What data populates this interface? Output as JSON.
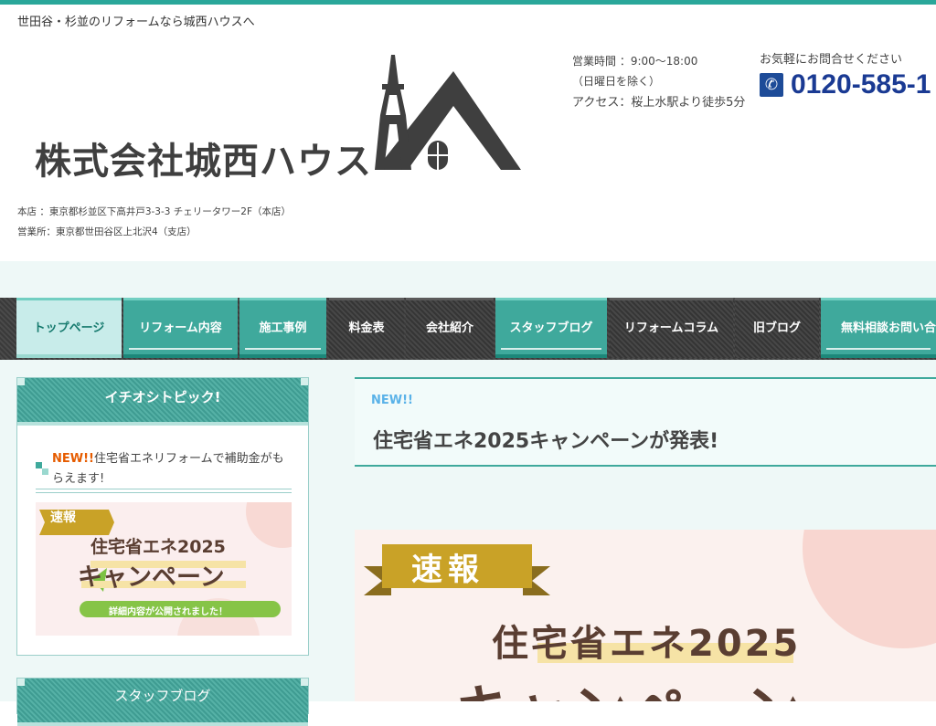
{
  "header": {
    "tagline": "世田谷・杉並のリフォームなら城西ハウスへ",
    "logo_text": "株式会社城西ハウス",
    "address_main": "本店 ：東京都杉並区下高井戸3-3-3 チェリータワー2F（本店）",
    "address_branch": "営業所：東京都世田谷区上北沢4（支店）",
    "hours_line1": "営業時間 ：9:00〜18:00",
    "hours_line2": "（日曜日を除く）",
    "access": "アクセス：桜上水駅より徒歩5分",
    "contact_label": "お気軽にお問合せください",
    "phone": "0120-585-1"
  },
  "nav": {
    "items": [
      {
        "label": "トップページ"
      },
      {
        "label": "リフォーム内容"
      },
      {
        "label": "施工事例"
      },
      {
        "label": "料金表"
      },
      {
        "label": "会社紹介"
      },
      {
        "label": "スタッフブログ"
      },
      {
        "label": "リフォームコラム"
      },
      {
        "label": "旧ブログ"
      },
      {
        "label": "無料相談お問い合"
      }
    ]
  },
  "sidebar": {
    "pickup_title": "イチオシトピック!",
    "pickup_new": "NEW!!",
    "pickup_text": "住宅省エネリフォームで補助金がもらえます!",
    "banner_badge": "速報",
    "banner_line1": "住宅省エネ2025",
    "banner_line2": "キャンペーン",
    "banner_sub": "詳細内容が公開されました！",
    "blog_title": "スタッフブログ"
  },
  "main": {
    "new_label": "NEW!!",
    "title": "住宅省エネ2025キャンペーンが発表!",
    "banner_badge": "速報",
    "banner_line1": "住宅省エネ2025",
    "banner_line2": "キャンペーン"
  },
  "colors": {
    "accent": "#3fa99c",
    "phone": "#1a3a93",
    "new": "#e65c00"
  }
}
